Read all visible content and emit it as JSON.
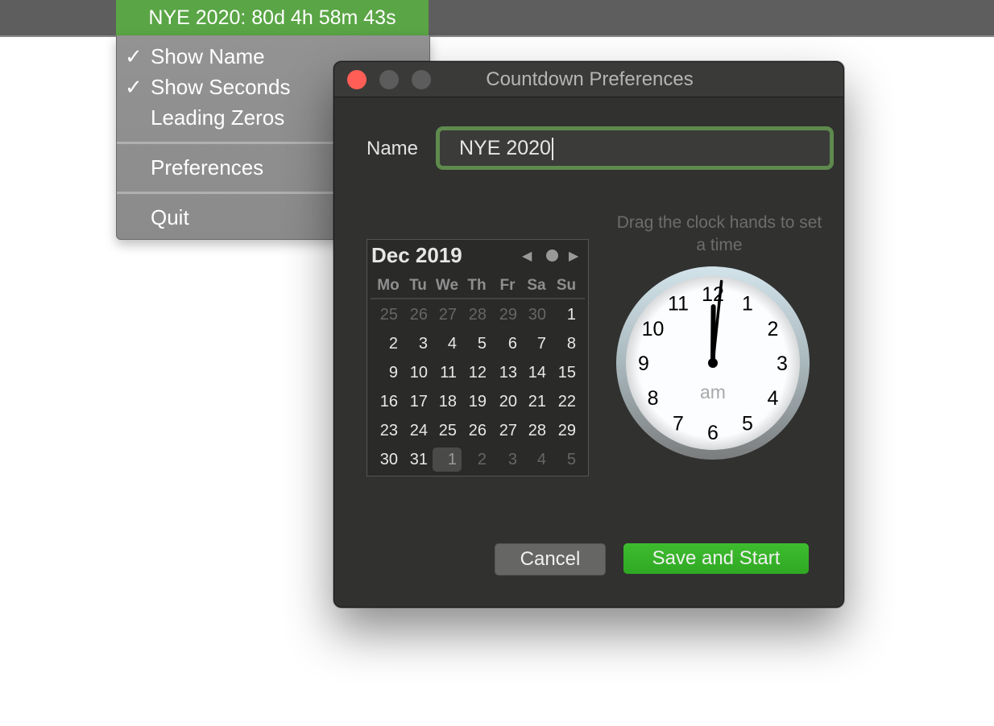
{
  "menubar": {
    "status_item": "NYE 2020: 80d 4h 58m 43s",
    "status_item_color": "#5aa546"
  },
  "dropdown_menu": {
    "items": [
      {
        "label": "Show Name",
        "checked": true,
        "check_glyph": "✓"
      },
      {
        "label": "Show Seconds",
        "checked": true,
        "check_glyph": "✓"
      },
      {
        "label": "Leading Zeros",
        "checked": false,
        "check_glyph": ""
      },
      {
        "label": "Preferences",
        "checked": false,
        "check_glyph": ""
      },
      {
        "label": "Quit",
        "checked": false,
        "check_glyph": ""
      }
    ]
  },
  "window": {
    "title": "Countdown Preferences",
    "traffic_lights": {
      "close": "#fe5e55",
      "minimize": "#5c5c5c",
      "zoom": "#5c5c5c"
    },
    "name_label": "Name",
    "name_value": "NYE 2020",
    "field_focus_color": "#5e8a4d",
    "calendar": {
      "month_label": "Dec 2019",
      "prev_glyph": "◀",
      "next_glyph": "▶",
      "today_icon": "dot-icon",
      "weekdays": [
        "Mo",
        "Tu",
        "We",
        "Th",
        "Fr",
        "Sa",
        "Su"
      ],
      "weeks": [
        [
          {
            "d": "25",
            "dim": true
          },
          {
            "d": "26",
            "dim": true
          },
          {
            "d": "27",
            "dim": true
          },
          {
            "d": "28",
            "dim": true
          },
          {
            "d": "29",
            "dim": true
          },
          {
            "d": "30",
            "dim": true
          },
          {
            "d": "1",
            "dim": false
          }
        ],
        [
          {
            "d": "2",
            "dim": false
          },
          {
            "d": "3",
            "dim": false
          },
          {
            "d": "4",
            "dim": false
          },
          {
            "d": "5",
            "dim": false
          },
          {
            "d": "6",
            "dim": false
          },
          {
            "d": "7",
            "dim": false
          },
          {
            "d": "8",
            "dim": false
          }
        ],
        [
          {
            "d": "9",
            "dim": false
          },
          {
            "d": "10",
            "dim": false
          },
          {
            "d": "11",
            "dim": false
          },
          {
            "d": "12",
            "dim": false
          },
          {
            "d": "13",
            "dim": false
          },
          {
            "d": "14",
            "dim": false
          },
          {
            "d": "15",
            "dim": false
          }
        ],
        [
          {
            "d": "16",
            "dim": false
          },
          {
            "d": "17",
            "dim": false
          },
          {
            "d": "18",
            "dim": false
          },
          {
            "d": "19",
            "dim": false
          },
          {
            "d": "20",
            "dim": false
          },
          {
            "d": "21",
            "dim": false
          },
          {
            "d": "22",
            "dim": false
          }
        ],
        [
          {
            "d": "23",
            "dim": false
          },
          {
            "d": "24",
            "dim": false
          },
          {
            "d": "25",
            "dim": false
          },
          {
            "d": "26",
            "dim": false
          },
          {
            "d": "27",
            "dim": false
          },
          {
            "d": "28",
            "dim": false
          },
          {
            "d": "29",
            "dim": false
          }
        ],
        [
          {
            "d": "30",
            "dim": false
          },
          {
            "d": "31",
            "dim": false
          },
          {
            "d": "1",
            "dim": false,
            "selected": true
          },
          {
            "d": "2",
            "dim": true
          },
          {
            "d": "3",
            "dim": true
          },
          {
            "d": "4",
            "dim": true
          },
          {
            "d": "5",
            "dim": true
          }
        ]
      ]
    },
    "clock": {
      "hint": "Drag the clock hands to set a time",
      "numerals": [
        "12",
        "1",
        "2",
        "3",
        "4",
        "5",
        "6",
        "7",
        "8",
        "9",
        "10",
        "11"
      ],
      "period": "am",
      "hour": 12,
      "minute": 1
    },
    "buttons": {
      "cancel": "Cancel",
      "save": "Save and Start",
      "save_color": "#34b027"
    }
  }
}
